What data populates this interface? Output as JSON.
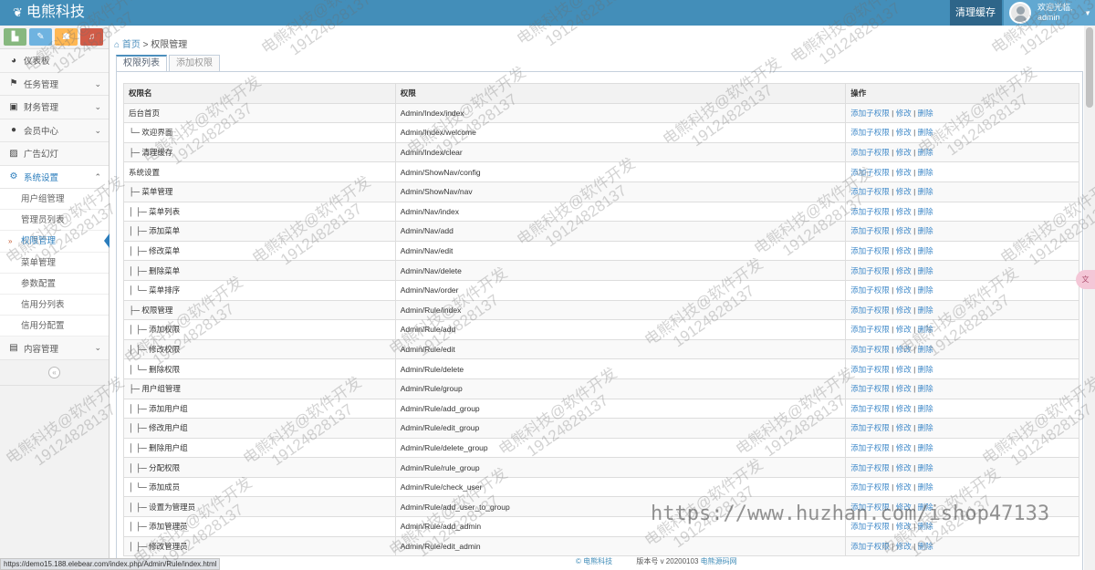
{
  "header": {
    "brand": "电熊科技",
    "clear_cache": "清理缓存",
    "welcome": "欢迎光临,",
    "username": "admin"
  },
  "sidebar": {
    "items": [
      {
        "label": "仪表板",
        "icon": "dashboard-icon"
      },
      {
        "label": "任务管理",
        "icon": "flag-icon"
      },
      {
        "label": "财务管理",
        "icon": "wallet-icon"
      },
      {
        "label": "会员中心",
        "icon": "user-icon"
      },
      {
        "label": "广告幻灯",
        "icon": "picture-icon"
      },
      {
        "label": "系统设置",
        "icon": "gear-icon"
      }
    ],
    "sub_items": [
      "用户组管理",
      "管理员列表",
      "权限管理",
      "菜单管理",
      "参数配置",
      "信用分列表",
      "信用分配置"
    ],
    "last_item": {
      "label": "内容管理",
      "icon": "book-icon"
    },
    "collapse": "«"
  },
  "breadcrumb": {
    "home": "首页",
    "current": "权限管理"
  },
  "tabs": [
    "权限列表",
    "添加权限"
  ],
  "table": {
    "headers": [
      "权限名",
      "权限",
      "操作"
    ],
    "actions": {
      "add": "添加子权限",
      "edit": "修改",
      "delete": "删除",
      "sep": "|"
    },
    "rows": [
      {
        "name": "后台首页",
        "rule": "Admin/Index/index"
      },
      {
        "name": "└─ 欢迎界面",
        "rule": "Admin/Index/welcome"
      },
      {
        "name": "├─ 清理缓存",
        "rule": "Admin/Index/clear"
      },
      {
        "name": "系统设置",
        "rule": "Admin/ShowNav/config"
      },
      {
        "name": "├─ 菜单管理",
        "rule": "Admin/ShowNav/nav"
      },
      {
        "name": "│  ├─ 菜单列表",
        "rule": "Admin/Nav/index"
      },
      {
        "name": "│  ├─ 添加菜单",
        "rule": "Admin/Nav/add"
      },
      {
        "name": "│  ├─ 修改菜单",
        "rule": "Admin/Nav/edit"
      },
      {
        "name": "│  ├─ 删除菜单",
        "rule": "Admin/Nav/delete"
      },
      {
        "name": "│  └─ 菜单排序",
        "rule": "Admin/Nav/order"
      },
      {
        "name": "├─ 权限管理",
        "rule": "Admin/Rule/index"
      },
      {
        "name": "│  ├─ 添加权限",
        "rule": "Admin/Rule/add"
      },
      {
        "name": "│  ├─ 修改权限",
        "rule": "Admin/Rule/edit"
      },
      {
        "name": "│  └─ 删除权限",
        "rule": "Admin/Rule/delete"
      },
      {
        "name": "├─ 用户组管理",
        "rule": "Admin/Rule/group"
      },
      {
        "name": "│  ├─ 添加用户组",
        "rule": "Admin/Rule/add_group"
      },
      {
        "name": "│  ├─ 修改用户组",
        "rule": "Admin/Rule/edit_group"
      },
      {
        "name": "│  ├─ 删除用户组",
        "rule": "Admin/Rule/delete_group"
      },
      {
        "name": "│  ├─ 分配权限",
        "rule": "Admin/Rule/rule_group"
      },
      {
        "name": "│  └─ 添加成员",
        "rule": "Admin/Rule/check_user"
      },
      {
        "name": "│  ├─ 设置为管理员",
        "rule": "Admin/Rule/add_user_to_group"
      },
      {
        "name": "│  ├─ 添加管理员",
        "rule": "Admin/Rule/add_admin"
      },
      {
        "name": "│  ├─ 修改管理员",
        "rule": "Admin/Rule/edit_admin"
      }
    ]
  },
  "footer": {
    "company": "© 电熊科技",
    "version": "版本号 v 20200103",
    "source": "电熊源码网"
  },
  "status_url": "https://demo15.188.elebear.com/index.php/Admin/Rule/index.html",
  "watermark": {
    "line1": "电熊科技@软件开发",
    "line2": "19124828137"
  },
  "site_mark": "https://www.huzhan.com/ishop47133",
  "float_badge": "文",
  "colors": {
    "topbar": "#438eb9",
    "link": "#428bca",
    "active_sub": "#2b7dbc"
  }
}
